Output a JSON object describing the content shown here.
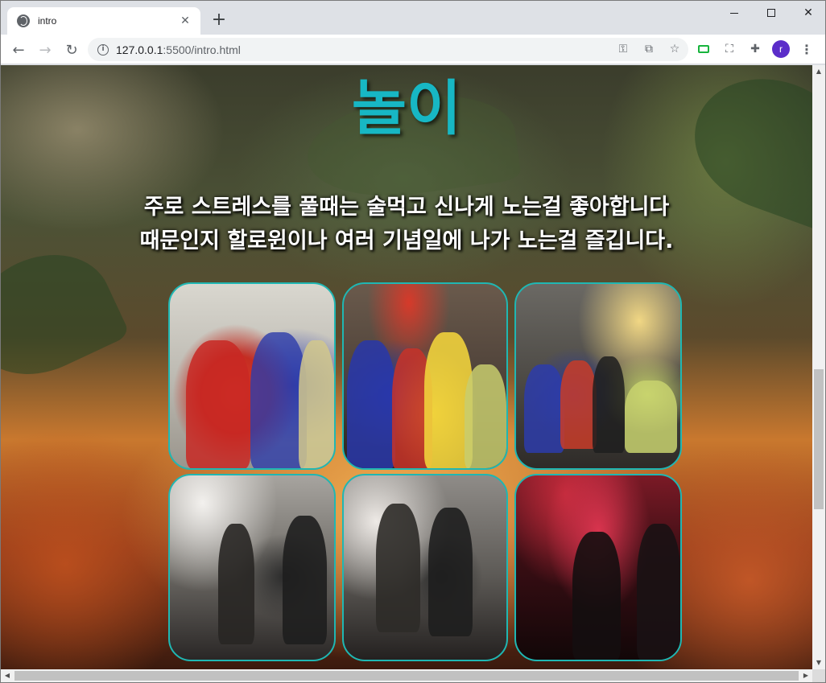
{
  "browser": {
    "tab_title": "intro",
    "tab_close": "✕",
    "new_tab": "+",
    "url_host": "127.0.0.1",
    "url_rest": ":5500/intro.html",
    "avatar_letter": "r",
    "accent": "#5b2dc9"
  },
  "page": {
    "heading": "놀이",
    "heading_color": "#17b7c4",
    "intro_line1": "주로 스트레스를 풀때는 술먹고 신나게 노는걸 좋아합니다",
    "intro_line2": "때문인지 할로윈이나 여러 기념일에 나가 노는걸 즐깁니다.",
    "photo_border_color": "#1fb7b3"
  },
  "gallery": [
    {
      "subject": "snow-white-dwarf-costume-selfie"
    },
    {
      "subject": "snow-white-group-street"
    },
    {
      "subject": "dwarf-costume-group-night-street"
    },
    {
      "subject": "trench-coat-men-dim-alley"
    },
    {
      "subject": "trench-coat-men-alley-2"
    },
    {
      "subject": "red-lit-club-crowd"
    }
  ]
}
